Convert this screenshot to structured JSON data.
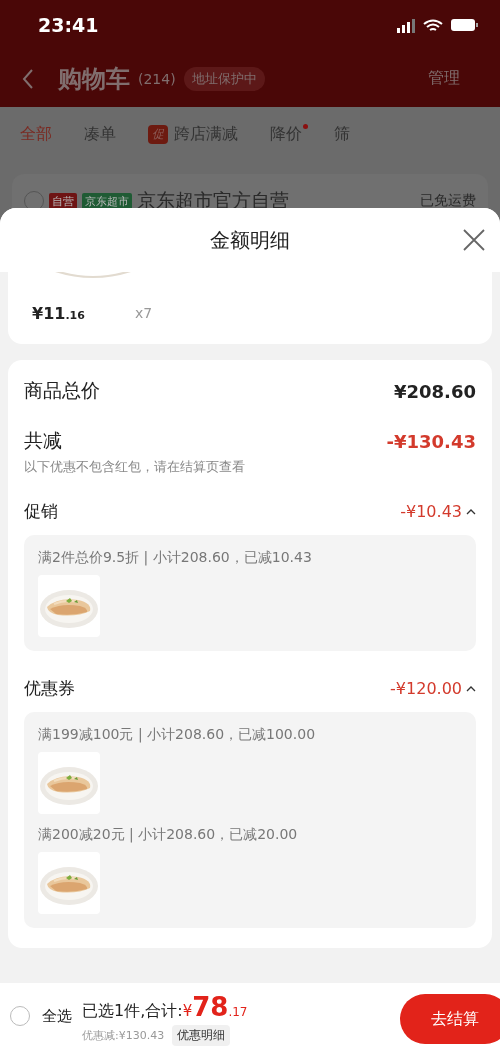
{
  "status_bar": {
    "time": "23:41"
  },
  "nav": {
    "title": "购物车",
    "count": "(214)",
    "badge": "地址保护中",
    "action": "管理"
  },
  "tabs": [
    {
      "label": "全部",
      "selected": true,
      "dot": false
    },
    {
      "label": "凑单",
      "selected": false,
      "dot": false
    },
    {
      "label": "跨店满减",
      "selected": false,
      "dot": false,
      "tag": "促"
    },
    {
      "label": "降价",
      "selected": false,
      "dot": true
    },
    {
      "label": "筛",
      "selected": false,
      "dot": false
    }
  ],
  "store": {
    "checked": false,
    "tags": [
      {
        "label": "自营",
        "color": "#6e1414"
      },
      {
        "label": "京东超市",
        "color": "#1f5b34"
      }
    ],
    "name": "京东超市官方自营",
    "shipping": "已免运费"
  },
  "sheet": {
    "title": "金额明细",
    "item": {
      "price": "¥11",
      "price_decimal": ".16",
      "quantity": "x7"
    },
    "summary": [
      {
        "kind": "total",
        "label": "商品总价",
        "amount": "¥208.60"
      },
      {
        "kind": "discount",
        "label": "共减",
        "amount": "-¥130.43",
        "note": "以下优惠不包含红包，请在结算页查看"
      }
    ],
    "sections": [
      {
        "label": "促销",
        "amount": "-¥10.43",
        "expanded": true,
        "entries": [
          {
            "text": "满2件总价9.5折 | 小计208.60，已减10.43"
          }
        ]
      },
      {
        "label": "优惠券",
        "amount": "-¥120.00",
        "expanded": true,
        "entries": [
          {
            "text": "满199减100元 | 小计208.60，已减100.00"
          },
          {
            "text": "满200减20元 | 小计208.60，已减20.00"
          }
        ]
      }
    ]
  },
  "bottom_bar": {
    "select_all": {
      "label": "全选",
      "checked": false
    },
    "summary_label": "已选1件,合计:",
    "currency": "¥",
    "total": "78",
    "total_decimal": ".17",
    "discount": "优惠减:¥130.43",
    "detail_button": "优惠明细",
    "checkout": "去结算"
  }
}
